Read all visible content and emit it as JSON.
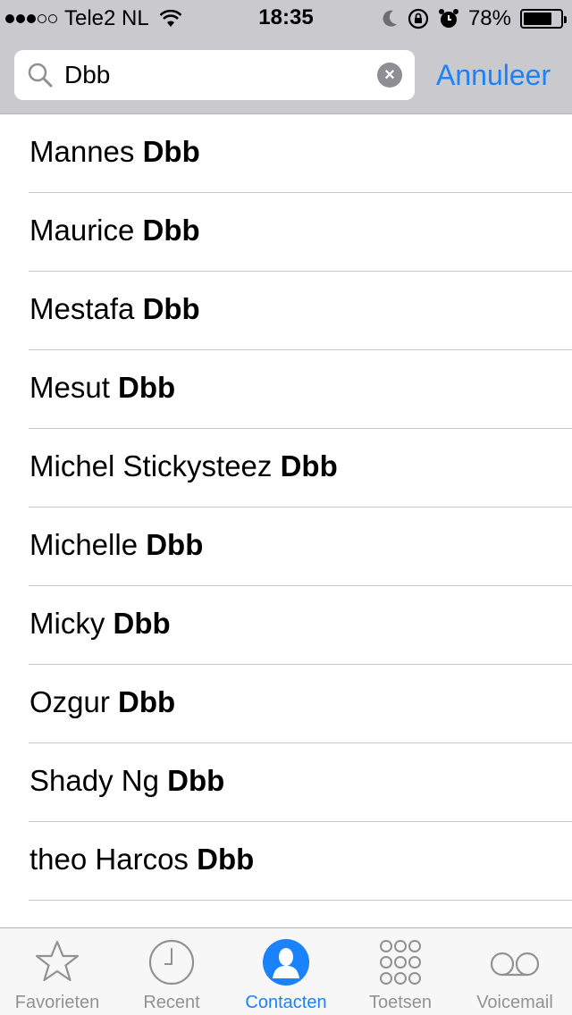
{
  "status_bar": {
    "carrier": "Tele2 NL",
    "time": "18:35",
    "battery_percent": "78%",
    "battery_level": 0.78,
    "signal_dots_filled": 3,
    "signal_dots_total": 5
  },
  "search": {
    "query": "Dbb",
    "cancel_label": "Annuleer"
  },
  "contacts": [
    {
      "first": "Mannes",
      "last": "Dbb"
    },
    {
      "first": "Maurice",
      "last": "Dbb"
    },
    {
      "first": "Mestafa",
      "last": "Dbb"
    },
    {
      "first": "Mesut",
      "last": "Dbb"
    },
    {
      "first": "Michel Stickysteez",
      "last": "Dbb"
    },
    {
      "first": "Michelle",
      "last": "Dbb"
    },
    {
      "first": "Micky",
      "last": "Dbb"
    },
    {
      "first": "Ozgur",
      "last": "Dbb"
    },
    {
      "first": "Shady Ng",
      "last": "Dbb"
    },
    {
      "first": "theo Harcos",
      "last": "Dbb"
    }
  ],
  "tabs": [
    {
      "label": "Favorieten",
      "icon": "star-icon"
    },
    {
      "label": "Recent",
      "icon": "clock-icon"
    },
    {
      "label": "Contacten",
      "icon": "contact-icon"
    },
    {
      "label": "Toetsen",
      "icon": "keypad-icon"
    },
    {
      "label": "Voicemail",
      "icon": "voicemail-icon"
    }
  ],
  "colors": {
    "accent": "#1a82fb",
    "inactive_tab": "#929292",
    "header_bg": "#c9c9ce"
  }
}
